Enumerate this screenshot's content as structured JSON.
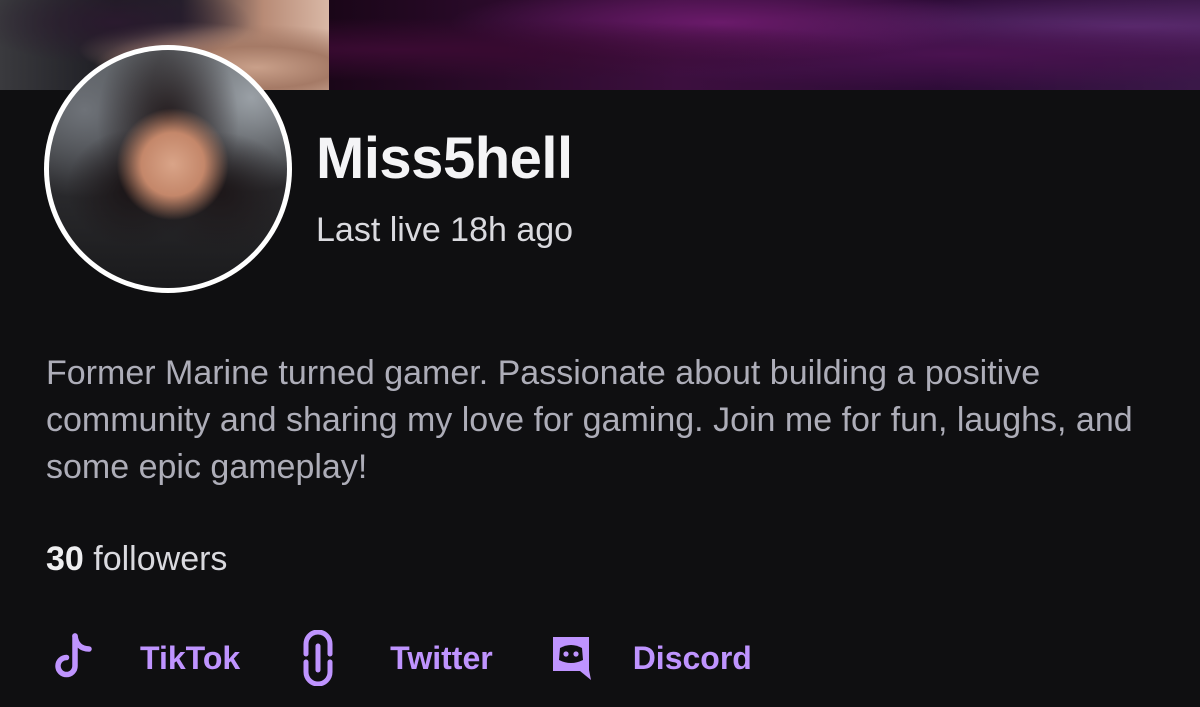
{
  "profile": {
    "username": "Miss5hell",
    "last_live": "Last live 18h ago",
    "bio": "Former Marine turned gamer. Passionate about building a positive community and sharing my love for gaming. Join me for fun, laughs, and some epic gameplay!",
    "followers_count": "30",
    "followers_label": " followers"
  },
  "socials": [
    {
      "label": "TikTok",
      "icon": "tiktok-icon"
    },
    {
      "label": "Twitter",
      "icon": "link-icon"
    },
    {
      "label": "Discord",
      "icon": "discord-icon"
    }
  ],
  "colors": {
    "background": "#0f0f11",
    "accent": "#bf94ff",
    "primary_text": "#efeff1",
    "secondary_text": "#adadb8"
  }
}
